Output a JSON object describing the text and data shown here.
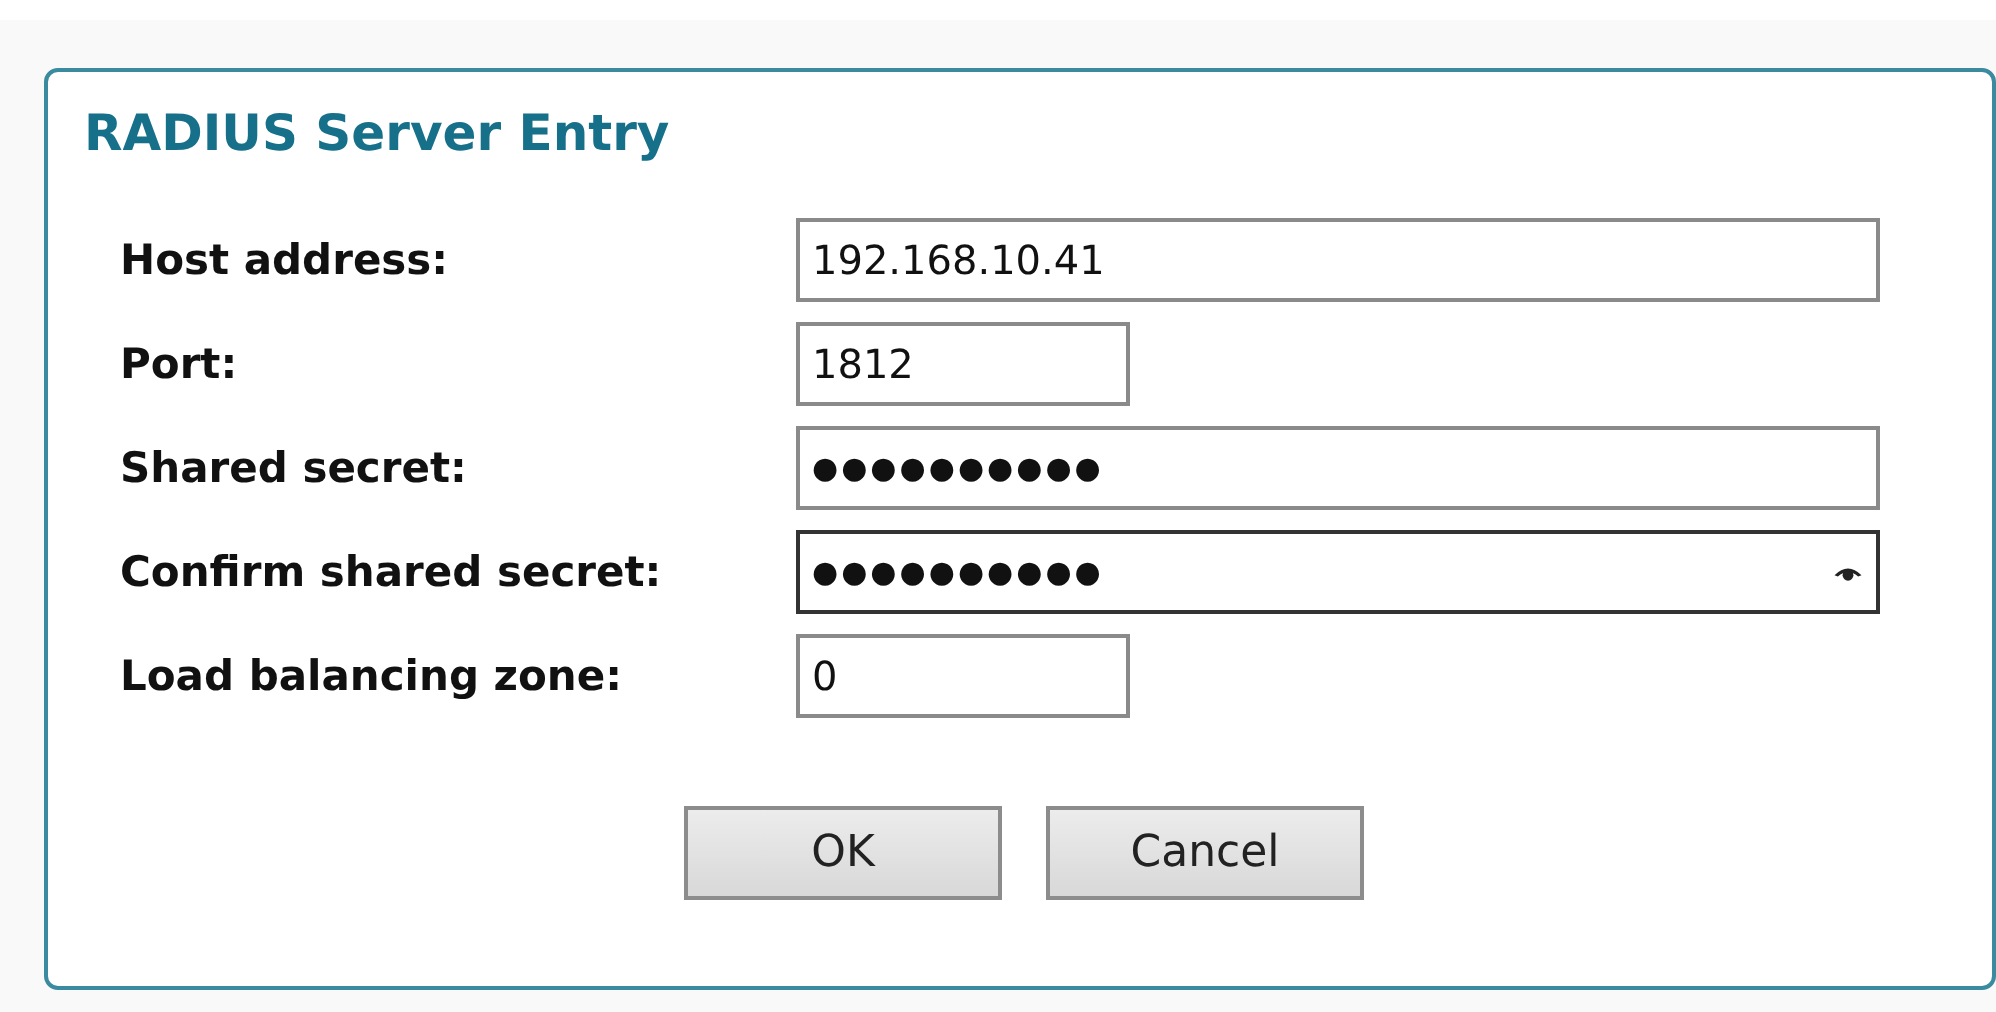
{
  "dialog": {
    "title": "RADIUS Server Entry"
  },
  "fields": [
    {
      "label": "Host address:",
      "value": "192.168.10.41",
      "kind": "text",
      "focused": false
    },
    {
      "label": "Port:",
      "value": "1812",
      "kind": "number",
      "focused": false
    },
    {
      "label": "Shared secret:",
      "value": "●●●●●●●●●●",
      "kind": "secret",
      "focused": false
    },
    {
      "label": "Confirm shared secret:",
      "value": "●●●●●●●●●●",
      "kind": "secret",
      "focused": true
    },
    {
      "label": "Load balancing zone:",
      "value": "0",
      "kind": "number",
      "focused": false
    }
  ],
  "buttons": [
    "OK",
    "Cancel"
  ]
}
